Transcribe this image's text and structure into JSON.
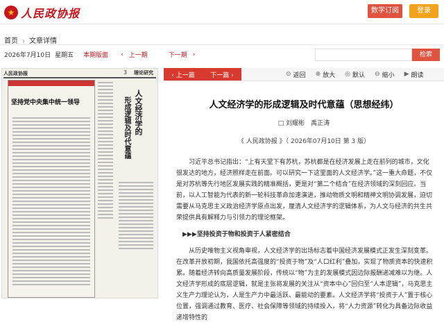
{
  "header": {
    "logo_text": "人民政协报",
    "subscribe_label": "数字订阅",
    "login_label": "登录"
  },
  "breadcrumb": {
    "home": "首页",
    "current": "文章详情"
  },
  "datebar": {
    "date": "2026年7月10日",
    "weekday": "星期五",
    "this_issue": "本期版面",
    "prev": "上一期",
    "next": "下一期"
  },
  "search": {
    "placeholder": "",
    "button_label": "检索"
  },
  "paper": {
    "masthead": "人民政协报",
    "page_number": "3",
    "page_tag": "理论研究",
    "box_title": "坚持党中央集中统一领导",
    "vertical_title": "人文经济学的",
    "vertical_title_2": "形成逻辑及时代意蕴"
  },
  "toolbar": {
    "prev_article": "上一篇",
    "next_article": "下一篇",
    "back": "返回",
    "zoom_in": "放大",
    "default": "默认",
    "zoom_out": "缩小",
    "read_aloud": "朗读"
  },
  "article": {
    "title": "人文经济学的形成逻辑及时代意蕴（思想经纬）",
    "author": "刘耀彬　禹正涛",
    "source": "《 人民政协报 》（ 2026年07月10日 第 3 版）",
    "para1": "习近平总书记指出：“上有天堂下有苏杭，苏杭都是在经济发展上走在前列的城市，文化很发达的地方，经济照样走在前面。可以研究一下这里面的人文经济学。”这一重大命题，不仅是对苏杭等先行地区发展实践的精准概括，更是对“第二个结合”在经济领域的深刻回应。当前，以人工智能为代表的新一轮科技革命加速演进，推动物质文明和精神文明协调发展，迫切需要从马克思主义政治经济学原点出发，厘清人文经济学的逻辑体系，为人文与经济的共生共荣提供具有解释力与引领力的理论框架。",
    "subheading": "▶▶▶坚持投资于物和投资于人紧密结合",
    "para2": "从历史唯物主义视角审视，人文经济学的出场标志着中国经济发展模式正发生深刻变革。在改革开放初期，我国依托高强度的“投资于物”及“人口红利”叠加，实现了物质资本的快速积累。随着经济转向高质量发展阶段，传统以“物”为主的发展模式因边际报酬递减难以为继。人文经济学形成的底层逻辑，就是主张将发展的关注从“资本中心”回归至“人本逻辑”，马克思主义生产力理论认为，人是生产力中最活跃、最能动的要素。人文经济学将“投资于人”置于核心位置，强调通过教育、医疗、社会保障等领域的持续投入，将“人力资源”转化为具备边际收益递增特性的"
  }
}
